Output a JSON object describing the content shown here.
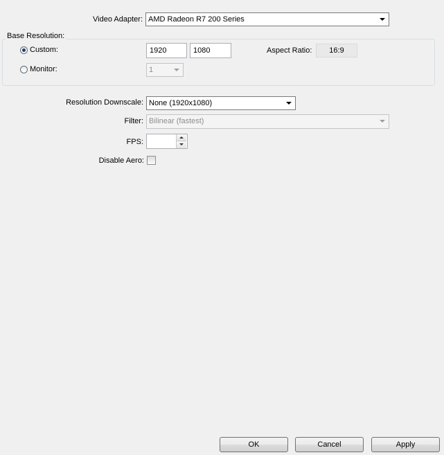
{
  "video_adapter": {
    "label": "Video Adapter:",
    "value": "AMD Radeon R7 200 Series"
  },
  "base_resolution": {
    "title": "Base Resolution:",
    "custom": {
      "label": "Custom:",
      "selected": true,
      "width": "1920",
      "height": "1080"
    },
    "aspect_ratio": {
      "label": "Aspect Ratio:",
      "value": "16:9"
    },
    "monitor": {
      "label": "Monitor:",
      "selected": false,
      "value": "1"
    }
  },
  "downscale": {
    "label": "Resolution Downscale:",
    "value": "None  (1920x1080)"
  },
  "filter": {
    "label": "Filter:",
    "value": "Bilinear (fastest)"
  },
  "fps": {
    "label": "FPS:",
    "value": ""
  },
  "disable_aero": {
    "label": "Disable Aero:",
    "checked": false
  },
  "buttons": {
    "ok": "OK",
    "cancel": "Cancel",
    "apply": "Apply"
  }
}
